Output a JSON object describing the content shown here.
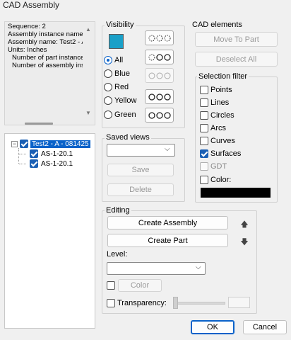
{
  "window": {
    "title": "CAD Assembly"
  },
  "info": {
    "lines": [
      "Sequence: 2",
      "Assembly instance name:",
      "Assembly name: Test2 - A",
      "Units: Inches",
      "Number of part instance",
      "Number of assembly inst"
    ]
  },
  "tree": {
    "root": "Test2 - A - 081425",
    "children": [
      "AS-1-20.1",
      "AS-1-20.1"
    ]
  },
  "visibility": {
    "label": "Visibility",
    "swatch_color": "#1aa0c8",
    "options": [
      "All",
      "Blue",
      "Red",
      "Yellow",
      "Green"
    ],
    "selected": "All"
  },
  "saved_views": {
    "label": "Saved views",
    "selected": "",
    "save_label": "Save",
    "delete_label": "Delete"
  },
  "cad_elements": {
    "label": "CAD elements",
    "move_to_part": "Move To Part",
    "deselect_all": "Deselect All"
  },
  "selection_filter": {
    "label": "Selection filter",
    "items": [
      {
        "label": "Points",
        "checked": false
      },
      {
        "label": "Lines",
        "checked": false
      },
      {
        "label": "Circles",
        "checked": false
      },
      {
        "label": "Arcs",
        "checked": false
      },
      {
        "label": "Curves",
        "checked": false
      },
      {
        "label": "Surfaces",
        "checked": true
      },
      {
        "label": "GDT",
        "checked": false,
        "disabled": true
      },
      {
        "label": "Color:",
        "checked": false
      }
    ],
    "color_value": "#000000"
  },
  "editing": {
    "label": "Editing",
    "create_assembly": "Create Assembly",
    "create_part": "Create Part",
    "level_label": "Level:",
    "level_value": "",
    "color_button": "Color",
    "transparency_label": "Transparency:"
  },
  "footer": {
    "ok": "OK",
    "cancel": "Cancel"
  }
}
